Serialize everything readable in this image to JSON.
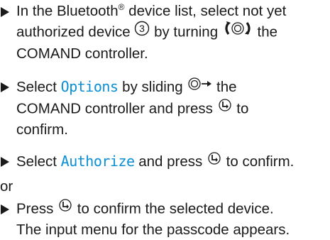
{
  "steps": [
    {
      "line1_a": "In the Bluetooth",
      "line1_sup": "®",
      "line1_b": " device list, select not yet",
      "line2_a": "authorized device ",
      "line2_num": "3",
      "line2_b": " by turning ",
      "line2_c": " the",
      "line3": "COMAND controller."
    },
    {
      "line1_a": "Select ",
      "line1_mono": "Options",
      "line1_b": " by sliding ",
      "line1_c": " the",
      "line2": "COMAND controller and press ",
      "line2_b": " to",
      "line3": "confirm."
    },
    {
      "line1_a": "Select ",
      "line1_mono": "Authorize",
      "line1_b": " and press ",
      "line1_c": " to confirm."
    },
    {
      "line1_a": "Press ",
      "line1_b": " to confirm the selected device.",
      "line2": "The input menu for the passcode appears."
    }
  ],
  "or_label": "or",
  "icons": [
    "triangle-bullet-icon",
    "circled-number-icon",
    "turn-controller-icon",
    "slide-right-icon",
    "press-controller-icon"
  ],
  "colors": {
    "highlight": "#0a8fd6",
    "text": "#1a1a1a"
  }
}
